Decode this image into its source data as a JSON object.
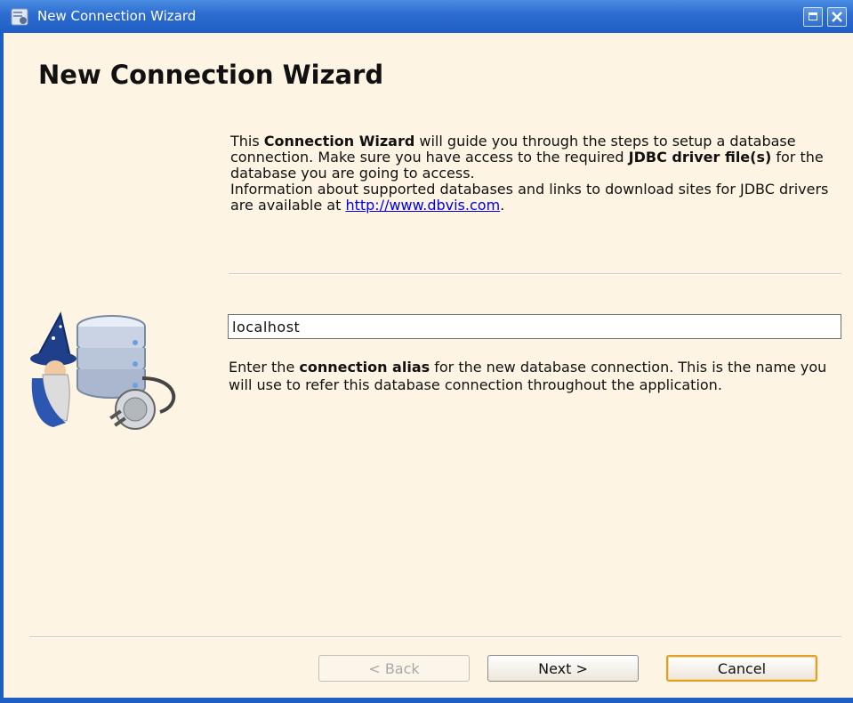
{
  "window": {
    "title": "New Connection Wizard",
    "controls": {
      "maximize": "maximize-icon",
      "close": "close-icon"
    },
    "colors": {
      "titlebar": "#2c6bcf",
      "background": "#fdf4e3",
      "link": "#0000ee",
      "default_button_ring": "#e0a030"
    }
  },
  "page": {
    "heading": "New Connection Wizard",
    "intro": {
      "part1": "This ",
      "bold1": "Connection Wizard",
      "part2": " will guide you through the steps to setup a database connection. Make sure you have access to the required ",
      "bold2": "JDBC driver file(s)",
      "part3": " for the database you are going to access."
    },
    "info": {
      "text": "Information about supported databases and links to download sites for JDBC drivers are available at ",
      "link": "http://www.dbvis.com",
      "suffix": "."
    },
    "alias": {
      "value": "localhost"
    },
    "hint": {
      "part1": "Enter the ",
      "bold": "connection alias",
      "part2": " for the new database connection. This is the name you will use to refer this database connection throughout the application."
    },
    "illustration": "wizard-database-plug-icon"
  },
  "buttons": {
    "back": "< Back",
    "next": "Next >",
    "cancel": "Cancel"
  }
}
